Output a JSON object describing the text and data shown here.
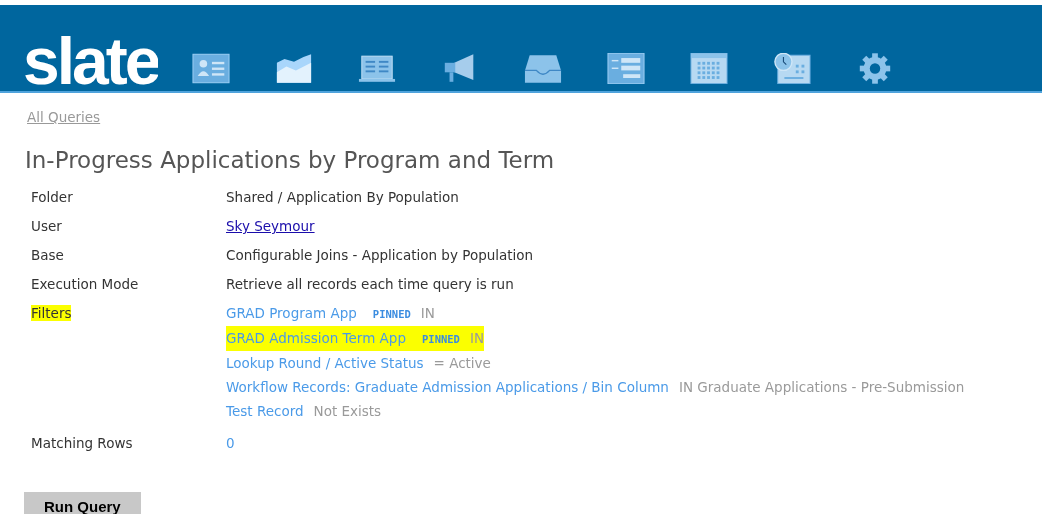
{
  "header": {
    "logo": "slate"
  },
  "breadcrumb": "All Queries",
  "title": "In-Progress Applications by Program and Term",
  "details": [
    {
      "label": "Folder",
      "kind": "text",
      "value": "Shared / Application By Population",
      "highlighted": false
    },
    {
      "label": "User",
      "kind": "link",
      "value": "Sky Seymour",
      "highlighted": false
    },
    {
      "label": "Base",
      "kind": "text",
      "value": "Configurable Joins - Application by Population",
      "highlighted": false
    },
    {
      "label": "Execution Mode",
      "kind": "text",
      "value": "Retrieve all records each time query is run",
      "highlighted": false
    },
    {
      "label": "Filters",
      "kind": "filters",
      "highlighted": true,
      "filters": [
        {
          "name": "GRAD Program App",
          "tag": "PINNED",
          "condition": "IN",
          "highlighted": false
        },
        {
          "name": "GRAD Admission Term App",
          "tag": "PINNED",
          "condition": "IN",
          "highlighted": true
        },
        {
          "name": "Lookup Round / Active Status",
          "condition": "= Active",
          "highlighted": false
        },
        {
          "name": "Workflow Records: Graduate Admission Applications / Bin Column",
          "condition": "IN Graduate Applications - Pre-Submission",
          "highlighted": false
        },
        {
          "name": "Test Record",
          "condition": "Not Exists",
          "highlighted": false
        }
      ]
    },
    {
      "label": "Matching Rows",
      "kind": "count",
      "value": "0",
      "highlighted": false
    }
  ],
  "button": "Run Query"
}
